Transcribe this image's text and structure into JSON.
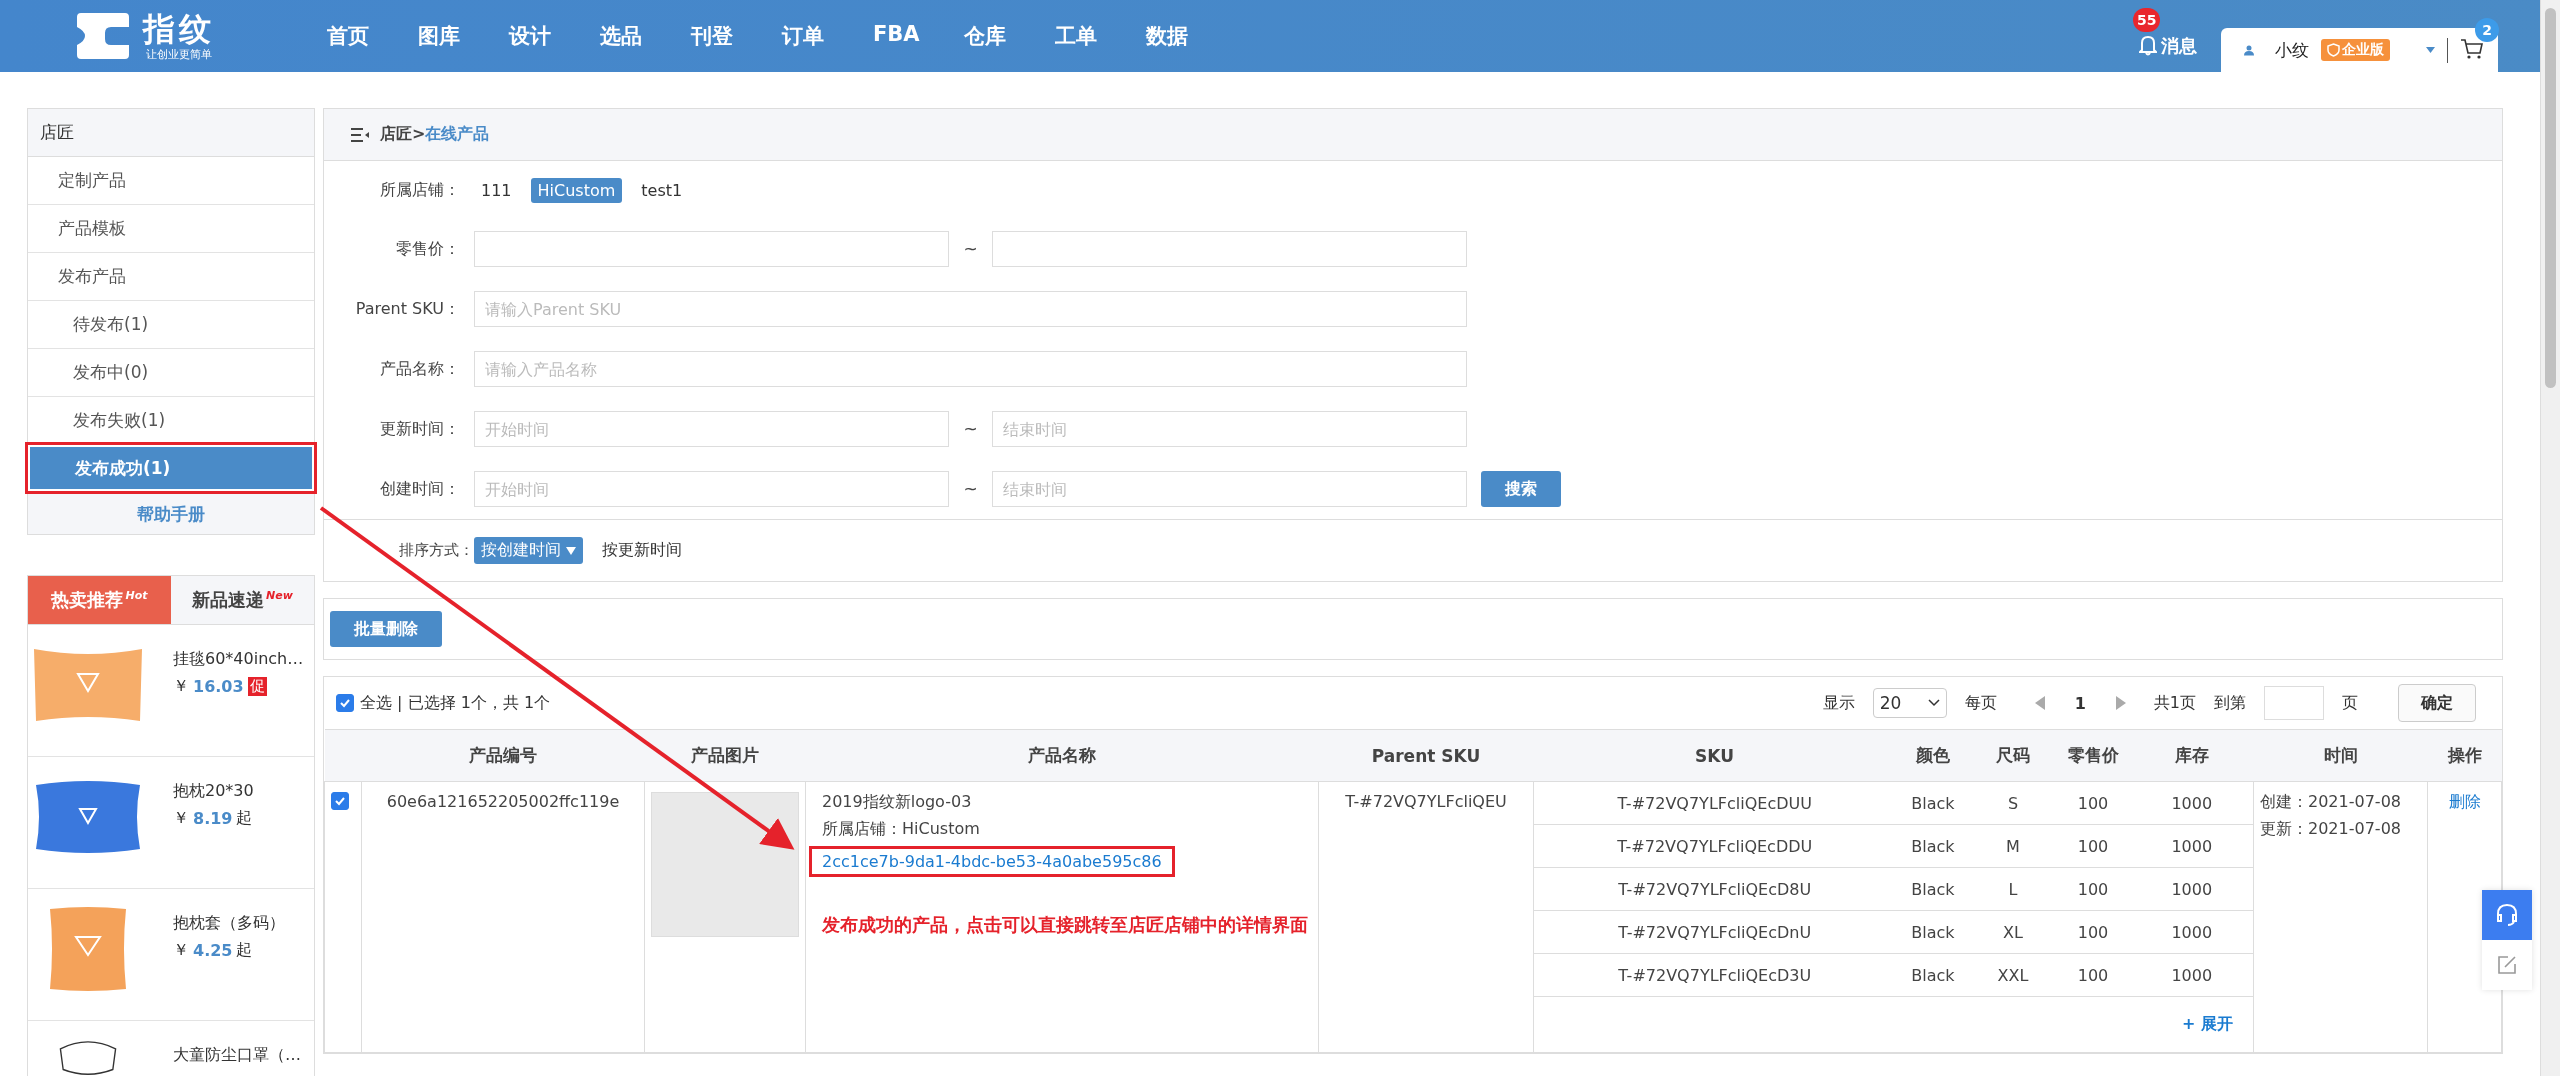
{
  "header": {
    "logo": {
      "name": "指纹",
      "slogan": "让创业更简单"
    },
    "nav": [
      "首页",
      "图库",
      "设计",
      "选品",
      "刊登",
      "订单",
      "FBA",
      "仓库",
      "工单",
      "数据"
    ],
    "messages": {
      "count": "55",
      "label": "消息"
    },
    "user": {
      "name": "小纹",
      "badge": "企业版"
    },
    "cart": {
      "count": "2"
    }
  },
  "sidebar": {
    "title": "店匠",
    "items": [
      {
        "label": "定制产品",
        "selected": false,
        "annotated": false
      },
      {
        "label": "产品模板",
        "selected": false,
        "annotated": false
      },
      {
        "label": "发布产品",
        "selected": false,
        "annotated": false,
        "children": [
          {
            "label": "待发布(1)",
            "selected": false,
            "annotated": false
          },
          {
            "label": "发布中(0)",
            "selected": false,
            "annotated": false
          },
          {
            "label": "发布失败(1)",
            "selected": false,
            "annotated": false
          },
          {
            "label": "发布成功(1)",
            "selected": true,
            "annotated": true
          }
        ]
      }
    ],
    "help": "帮助手册"
  },
  "promo": {
    "tabs": [
      {
        "label": "热卖推荐",
        "tag": "Hot",
        "selected": true
      },
      {
        "label": "新品速递",
        "tag": "New",
        "selected": false
      }
    ],
    "products": [
      {
        "kind": "tapestry",
        "name": "挂毯60*40inch…",
        "currency": "￥",
        "price": "16.03",
        "suffix": "促",
        "promo": true
      },
      {
        "kind": "pillow",
        "name": "抱枕20*30",
        "currency": "￥",
        "price": "8.19",
        "suffix": "起",
        "promo": false
      },
      {
        "kind": "cushion",
        "name": "抱枕套（多码）",
        "currency": "￥",
        "price": "4.25",
        "suffix": "起",
        "promo": false
      },
      {
        "kind": "mask",
        "name": "大童防尘口罩（…"
      }
    ]
  },
  "breadcrumb": {
    "parent": "店匠>",
    "current": "在线产品"
  },
  "filters": {
    "store": {
      "label": "所属店铺：",
      "options": [
        {
          "label": "111",
          "selected": false
        },
        {
          "label": "HiCustom",
          "selected": true
        },
        {
          "label": "test1",
          "selected": false
        }
      ]
    },
    "price": {
      "label": "零售价：",
      "separator": "~"
    },
    "parent_sku": {
      "label": "Parent SKU：",
      "placeholder": "请输入Parent SKU"
    },
    "product_name": {
      "label": "产品名称：",
      "placeholder": "请输入产品名称"
    },
    "update_time": {
      "label": "更新时间：",
      "from_placeholder": "开始时间",
      "separator": "~",
      "to_placeholder": "结束时间"
    },
    "create_time": {
      "label": "创建时间：",
      "from_placeholder": "开始时间",
      "separator": "~",
      "to_placeholder": "结束时间"
    },
    "search_button": "搜索",
    "sort": {
      "label": "排序方式：",
      "options": [
        {
          "label": "按创建时间",
          "selected": true
        },
        {
          "label": "按更新时间",
          "selected": false
        }
      ]
    }
  },
  "batch_delete": "批量删除",
  "toolbar": {
    "select_all": {
      "checked": true,
      "label": "全选 | 已选择 1个，共 1个"
    },
    "pagination": {
      "show_label": "显示",
      "page_size": "20",
      "per_page": "每页",
      "page": "1",
      "total": "共1页",
      "goto": "到第",
      "page_unit": "页",
      "confirm": "确定"
    }
  },
  "table": {
    "columns": [
      "产品编号",
      "产品图片",
      "产品名称",
      "Parent SKU",
      "SKU",
      "颜色",
      "尺码",
      "零售价",
      "库存",
      "时间",
      "操作"
    ],
    "rows": [
      {
        "checked": true,
        "id": "60e6a121652205002ffc119e",
        "name": "2019指纹新logo-03",
        "store": "所属店铺：HiCustom",
        "link": "2cc1ce7b-9da1-4bdc-be53-4a0abe595c86",
        "link_annotated": true,
        "parent_sku": "T-#72VQ7YLFcliQEU",
        "variants": [
          {
            "sku": "T-#72VQ7YLFcliQEcDUU",
            "color_name": "Black",
            "size": "S",
            "price": "100",
            "stock": "1000"
          },
          {
            "sku": "T-#72VQ7YLFcliQEcDDU",
            "color_name": "Black",
            "size": "M",
            "price": "100",
            "stock": "1000"
          },
          {
            "sku": "T-#72VQ7YLFcliQEcD8U",
            "color_name": "Black",
            "size": "L",
            "price": "100",
            "stock": "1000"
          },
          {
            "sku": "T-#72VQ7YLFcliQEcDnU",
            "color_name": "Black",
            "size": "XL",
            "price": "100",
            "stock": "1000"
          },
          {
            "sku": "T-#72VQ7YLFcliQEcD3U",
            "color_name": "Black",
            "size": "XXL",
            "price": "100",
            "stock": "1000"
          }
        ],
        "expand": "+ 展开",
        "created": "创建：2021-07-08",
        "updated": "更新：2021-07-08",
        "action": "删除"
      }
    ]
  },
  "annotation": {
    "text": "发布成功的产品，点击可以直接跳转至店匠店铺中的详情界面"
  }
}
